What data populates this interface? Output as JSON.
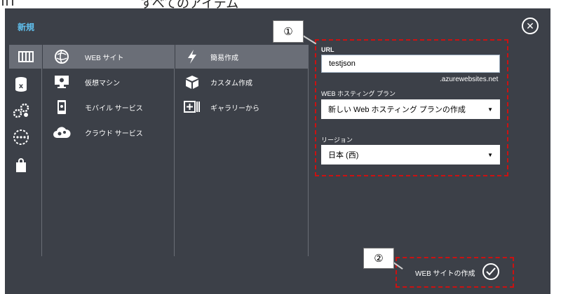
{
  "background_title": "すべてのアイテム",
  "dialog": {
    "section_label": "新規",
    "close_label": "✕"
  },
  "categories": [
    {
      "icon": "web-apps-icon",
      "active": true
    },
    {
      "icon": "sql-database-icon",
      "active": false
    },
    {
      "icon": "cloud-services-gears-icon",
      "active": false
    },
    {
      "icon": "more-services-icon",
      "active": false
    },
    {
      "icon": "store-bag-icon",
      "active": false
    }
  ],
  "compute_items": [
    {
      "label": "WEB サイト",
      "icon": "globe-icon",
      "active": true
    },
    {
      "label": "仮想マシン",
      "icon": "monitor-icon",
      "active": false
    },
    {
      "label": "モバイル サービス",
      "icon": "mobile-icon",
      "active": false
    },
    {
      "label": "クラウド サービス",
      "icon": "cloud-gears-icon",
      "active": false
    }
  ],
  "create_options": [
    {
      "label": "簡易作成",
      "icon": "lightning-icon",
      "active": true
    },
    {
      "label": "カスタム作成",
      "icon": "box-icon",
      "active": false
    },
    {
      "label": "ギャラリーから",
      "icon": "gallery-add-icon",
      "active": false
    }
  ],
  "form": {
    "url_label": "URL",
    "url_value": "testjson",
    "url_suffix": ".azurewebsites.net",
    "plan_label": "WEB ホスティング プラン",
    "plan_value": "新しい Web ホスティング プランの作成",
    "region_label": "リージョン",
    "region_value": "日本 (西)",
    "dropdown_arrow": "▼"
  },
  "footer": {
    "create_label": "WEB サイトの作成",
    "confirm_icon": "check-icon"
  },
  "annotations": {
    "callout1": "①",
    "callout2": "②",
    "highlight_color": "#cc1111"
  },
  "colors": {
    "dialog_bg": "#3c4048",
    "active_item": "#6a6e77",
    "accent_blue": "#60c0ee"
  }
}
